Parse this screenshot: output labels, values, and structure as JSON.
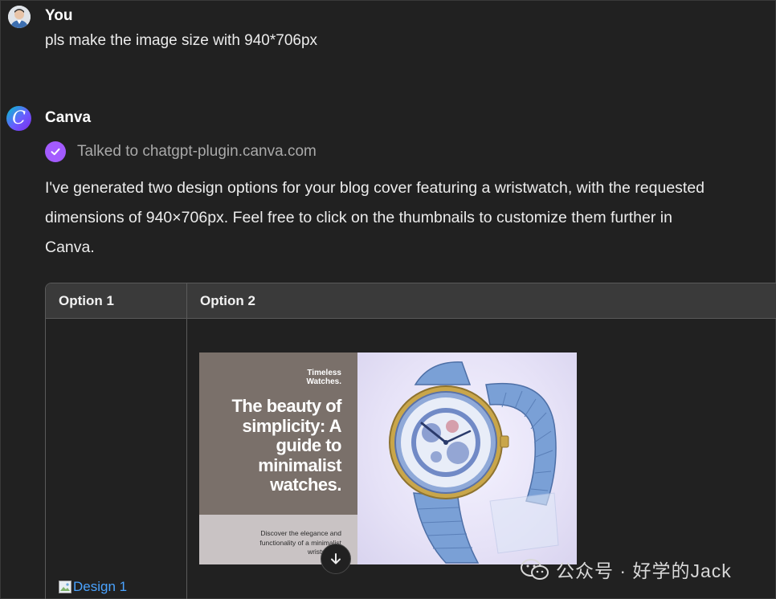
{
  "user_message": {
    "author": "You",
    "text": "pls make the image size with 940*706px"
  },
  "assistant_message": {
    "author": "Canva",
    "avatar_letter": "C",
    "plugin_status": "Talked to chatgpt-plugin.canva.com",
    "body_line_1": "I've generated two design options for your blog cover featuring a wristwatch, with the requested",
    "body_line_2": "dimensions of 940×706px. Feel free to click on the thumbnails to customize them further in",
    "body_line_3": "Canva."
  },
  "table": {
    "headers": [
      "Option 1",
      "Option 2"
    ],
    "option1_image_alt": "Design 1",
    "option2_design": {
      "kicker_line1": "Timeless",
      "kicker_line2": "Watches.",
      "title_line1": "The beauty of",
      "title_line2": "simplicity: A",
      "title_line3": "guide to",
      "title_line4": "minimalist",
      "title_line5": "watches.",
      "subtitle_line1": "Discover the elegance and",
      "subtitle_line2": "functionality of a minimalist",
      "subtitle_line3": "wristwatch."
    }
  },
  "watermark": "公众号 · 好学的Jack",
  "icons": {
    "user_avatar": "user-avatar",
    "assistant_avatar": "canva-logo-icon",
    "plugin_check": "check-badge-icon",
    "scroll_down": "arrow-down-icon",
    "broken_image": "broken-image-icon",
    "watermark": "wechat-icon"
  },
  "colors": {
    "background": "#212121",
    "table_header": "#3a3a3a",
    "plugin_badge": "#a35bff",
    "link": "#4aa3ff",
    "design_panel": "#7a706a"
  }
}
